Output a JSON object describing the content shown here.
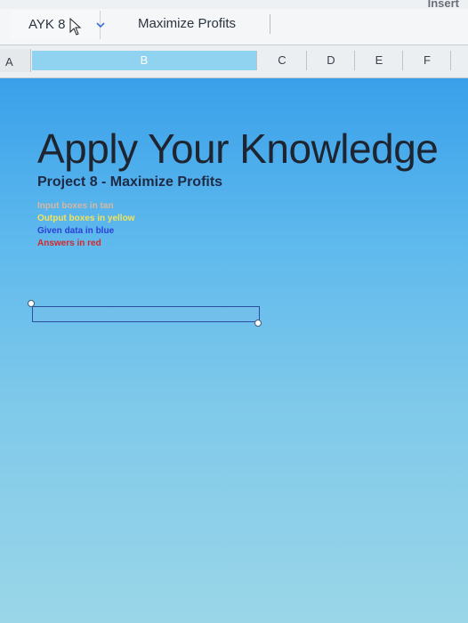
{
  "toolbar": {
    "insert_label": "Insert"
  },
  "formula_bar": {
    "name_box_value": "AYK 8",
    "formula_content": "Maximize Profits"
  },
  "columns": {
    "a": "A",
    "b": "B",
    "c": "C",
    "d": "D",
    "e": "E",
    "f": "F"
  },
  "sheet": {
    "title": "Apply Your Knowledge",
    "subtitle": "Project 8 - Maximize Profits",
    "legend": {
      "tan": "Input boxes in tan",
      "yellow": "Output boxes in yellow",
      "blue": "Given data in blue",
      "red": "Answers in red"
    }
  },
  "colors": {
    "tan": "#d9b7a0",
    "yellow": "#f2e35a",
    "blue": "#2d3fd6",
    "red": "#d8262b"
  }
}
